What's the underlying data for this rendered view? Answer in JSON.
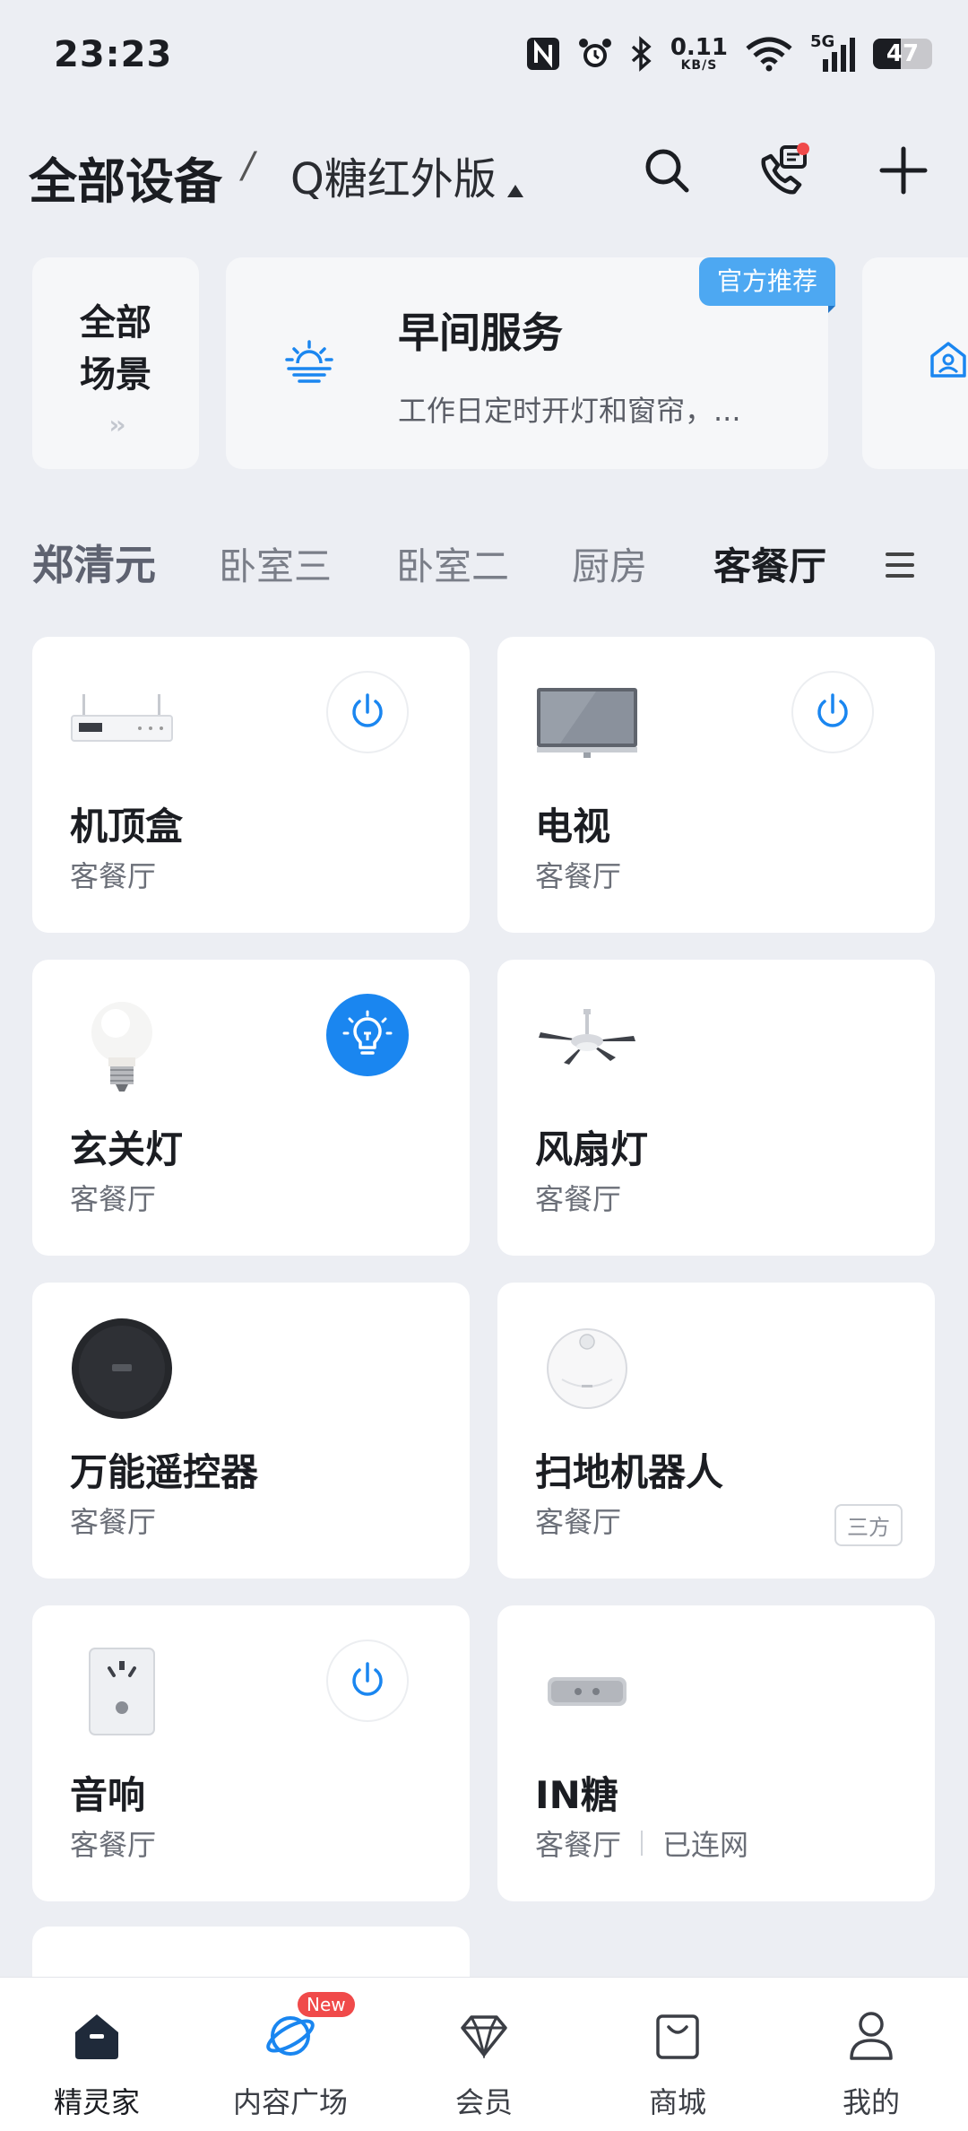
{
  "status_bar": {
    "time": "23:23",
    "net_speed_value": "0.11",
    "net_speed_unit": "KB/S",
    "signal_label": "5G",
    "battery_percent": "47",
    "battery_level": 0.47
  },
  "header": {
    "title": "全部设备",
    "separator": "/",
    "home_name": "Q糖红外版"
  },
  "scenes": {
    "all_label_line1": "全部",
    "all_label_line2": "场景",
    "all_arrow": "››",
    "featured": {
      "badge": "官方推荐",
      "name": "早间服务",
      "description": "工作日定时开灯和窗帘，..."
    }
  },
  "rooms": {
    "owner": "郑清元",
    "tabs": [
      "卧室三",
      "卧室二",
      "厨房",
      "客餐厅"
    ],
    "active_tab": "客餐厅"
  },
  "devices": [
    {
      "name": "机顶盒",
      "room": "客餐厅",
      "icon": "set-top-box-icon",
      "power": "off"
    },
    {
      "name": "电视",
      "room": "客餐厅",
      "icon": "tv-icon",
      "power": "off"
    },
    {
      "name": "玄关灯",
      "room": "客餐厅",
      "icon": "light-bulb-icon",
      "power": "on"
    },
    {
      "name": "风扇灯",
      "room": "客餐厅",
      "icon": "ceiling-fan-icon"
    },
    {
      "name": "万能遥控器",
      "room": "客餐厅",
      "icon": "universal-remote-icon"
    },
    {
      "name": "扫地机器人",
      "room": "客餐厅",
      "icon": "robot-vacuum-icon",
      "tag": "三方"
    },
    {
      "name": "音响",
      "room": "客餐厅",
      "icon": "smart-plug-icon",
      "power": "off"
    },
    {
      "name": "IN糖",
      "room": "客餐厅",
      "status": "已连网",
      "icon": "in-tang-sensor-icon"
    }
  ],
  "bottom_nav": {
    "items": [
      "精灵家",
      "内容广场",
      "会员",
      "商城",
      "我的"
    ],
    "active": "精灵家",
    "new_badge": "New"
  },
  "colors": {
    "accent": "#1a86f0",
    "badge_blue": "#4da8f2",
    "background": "#eceef3",
    "notification_red": "#f04a4a"
  }
}
